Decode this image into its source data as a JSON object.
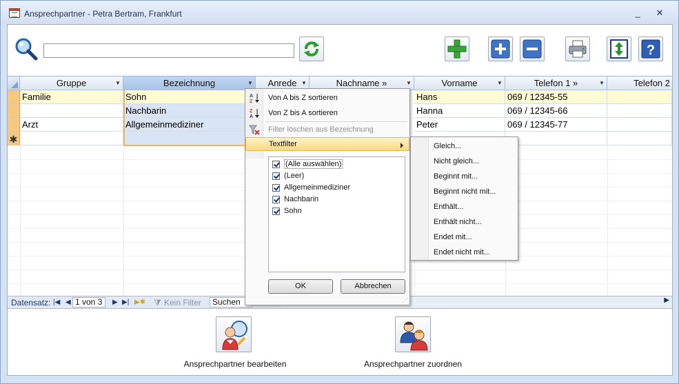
{
  "window": {
    "title": "Ansprechpartner - Petra Bertram, Frankfurt",
    "minimize": "_",
    "close": "✕"
  },
  "toolbar": {
    "search_value": ""
  },
  "grid": {
    "columns": [
      "Gruppe",
      "Bezeichnung",
      "Anrede",
      "Nachname »",
      "Vorname",
      "Telefon 1 »",
      "Telefon 2"
    ],
    "rows": [
      {
        "gruppe": "Familie",
        "bezeichnung": "Sohn",
        "vorname": "Hans",
        "telefon1": "069 / 12345-55"
      },
      {
        "gruppe": "",
        "bezeichnung": "Nachbarin",
        "vorname": "Hanna",
        "telefon1": "069 / 12345-66"
      },
      {
        "gruppe": "Arzt",
        "bezeichnung": "Allgemeinmediziner",
        "vorname": "Peter",
        "telefon1": "069 / 12345-77"
      }
    ],
    "new_row_marker": "✱"
  },
  "navbar": {
    "label": "Datensatz:",
    "record_display": "1 von 3",
    "no_filter": "Kein Filter",
    "search": "Suchen"
  },
  "filter_menu": {
    "sort_asc": "Von A bis Z sortieren",
    "sort_desc": "Von Z bis A sortieren",
    "clear_filter": "Filter löschen aus Bezeichnung",
    "text_filter": "Textfilter",
    "values": [
      "(Alle auswählen)",
      "(Leer)",
      "Allgemeinmediziner",
      "Nachbarin",
      "Sohn"
    ],
    "ok": "OK",
    "cancel": "Abbrechen"
  },
  "text_filter_menu": [
    "Gleich...",
    "Nicht gleich...",
    "Beginnt mit...",
    "Beginnt nicht mit...",
    "Enthält...",
    "Enthält nicht...",
    "Endet mit...",
    "Endet nicht mit..."
  ],
  "bottom": {
    "edit_label": "Ansprechpartner bearbeiten",
    "assign_label": "Ansprechpartner zuordnen"
  },
  "colors": {
    "accent_orange": "#f3b25c",
    "row_highlight": "#fffbd2",
    "header_active": "#a9c4e8"
  }
}
